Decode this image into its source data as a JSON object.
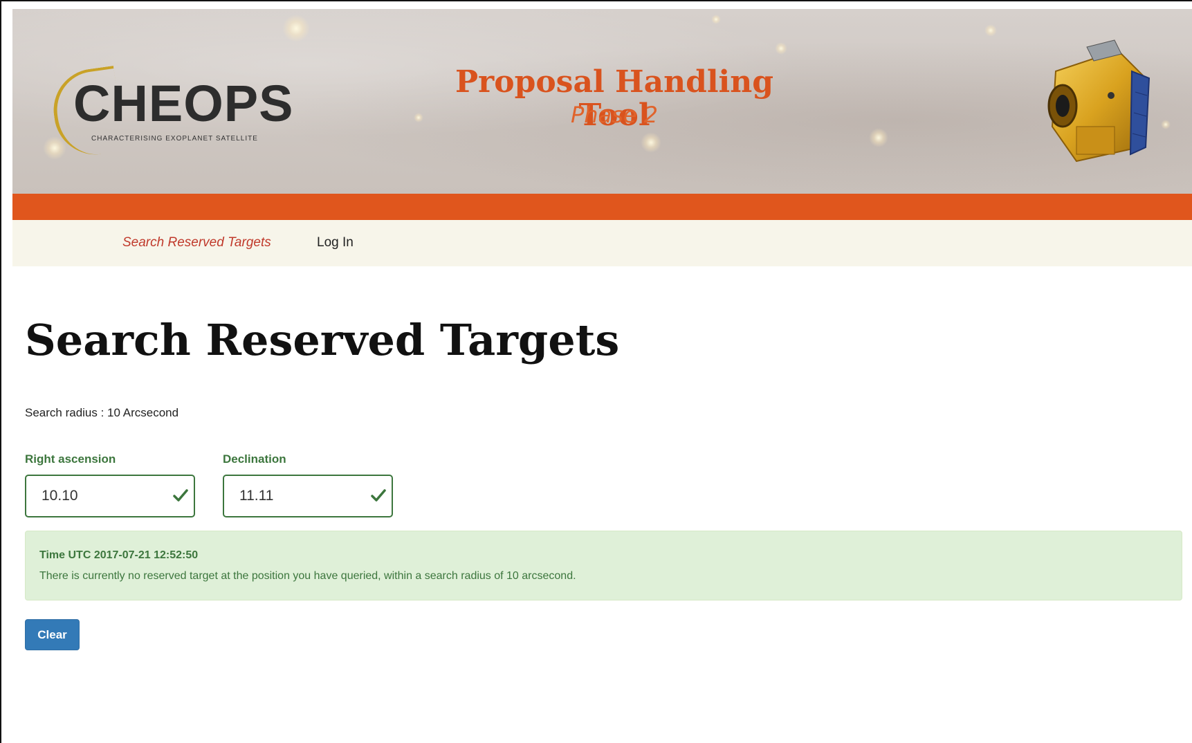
{
  "header": {
    "logo": {
      "name": "CHEOPS",
      "tagline": "CHARACTERISING EXOPLANET SATELLITE"
    },
    "title": "Proposal Handling Tool",
    "subtitle": "Phase 2",
    "satellite_icon": "satellite-illustration",
    "colors": {
      "accent": "#d9531e",
      "bar": "#e0561d",
      "logo_arc": "#c9a227"
    }
  },
  "nav": {
    "items": [
      {
        "label": "Search Reserved Targets",
        "active": true
      },
      {
        "label": "Log In",
        "active": false
      }
    ],
    "background": "#f7f5ea"
  },
  "main": {
    "title": "Search Reserved Targets",
    "search_radius_text": "Search radius : 10 Arcsecond",
    "fields": {
      "ra": {
        "label": "Right ascension",
        "value": "10.10",
        "valid": true
      },
      "dec": {
        "label": "Declination",
        "value": "11.11",
        "valid": true
      }
    },
    "result": {
      "time": "Time UTC 2017-07-21 12:52:50",
      "message": "There is currently no reserved target at the position you have queried, within a search radius of 10 arcsecond.",
      "status_color": "#3c763d",
      "background": "#dff0d8"
    },
    "clear_button": {
      "label": "Clear",
      "color": "#337ab7"
    }
  }
}
